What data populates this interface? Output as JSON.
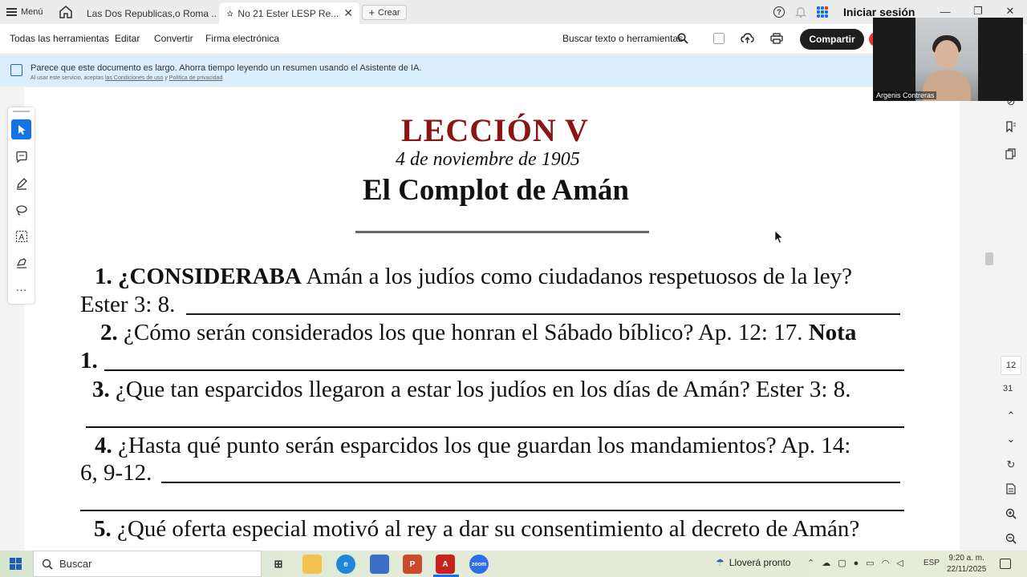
{
  "browser": {
    "menu_label": "Menú",
    "tabs": [
      {
        "label": "Las Dos Republicas,o Roma ..."
      },
      {
        "label": "No 21 Ester LESP Re..."
      }
    ],
    "create_label": "Crear",
    "signin_label": "Iniciar sesión"
  },
  "toolbar": {
    "items": [
      "Todas las herramientas",
      "Editar",
      "Convertir",
      "Firma electrónica"
    ],
    "search_label": "Buscar texto o herramientas",
    "share_label": "Compartir"
  },
  "ai_banner": {
    "text": "Parece que este documento es largo. Ahorra tiempo leyendo un resumen usando el Asistente de IA.",
    "sub_prefix": "Al usar este servicio, aceptas",
    "terms_link": "las Condiciones de uso",
    "sub_and": "y",
    "privacy_link": "Política de privacidad"
  },
  "video": {
    "name": "Argenis Contreras"
  },
  "document": {
    "title": "LECCIÓN V",
    "date": "4 de noviembre de 1905",
    "subtitle": "El Complot de Amán",
    "q1_num": "1.",
    "q1_bold": "¿CONSIDERABA",
    "q1_rest": "Amán a los judíos como ciudadanos respetuosos de la ley?",
    "q1_ref": "Ester 3: 8.",
    "q2_num": "2.",
    "q2_text": "¿Cómo serán considerados los que honran el Sábado bíblico? Ap. 12: 17.",
    "q2_note": "Nota",
    "q2_note_num": "1.",
    "q3_num": "3.",
    "q3_text": "¿Que tan esparcidos llegaron a estar los judíos en los días de Amán? Ester 3: 8.",
    "q4_num": "4.",
    "q4_text": "¿Hasta qué punto serán esparcidos los que guardan los mandamientos? Ap. 14:",
    "q4_ref": "6, 9-12.",
    "q5_num": "5.",
    "q5_text": "¿Qué oferta especial motivó al rey a dar su consentimiento al decreto de Amán?"
  },
  "page_nav": {
    "current": "12",
    "total": "31"
  },
  "taskbar": {
    "search_placeholder": "Buscar",
    "weather": "Lloverá pronto",
    "lang": "ESP",
    "time": "9:20 a. m.",
    "date": "22/11/2025"
  },
  "colors": {
    "title_red": "#8b1515",
    "banner_bg": "#dbeefb",
    "accent_blue": "#1473e6",
    "share_bg": "#1e1e1e"
  }
}
